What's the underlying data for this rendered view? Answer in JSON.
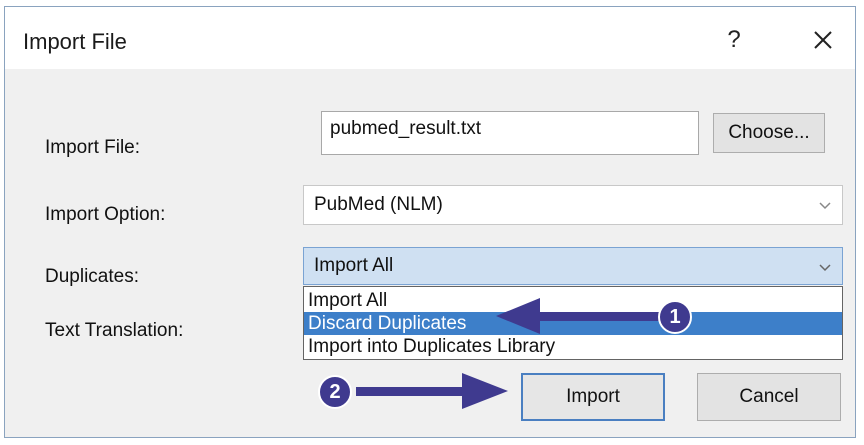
{
  "window": {
    "title": "Import File",
    "help_label": "?"
  },
  "form": {
    "import_file": {
      "label": "Import File:",
      "value": "pubmed_result.txt",
      "choose_label": "Choose..."
    },
    "import_option": {
      "label": "Import Option:",
      "value": "PubMed (NLM)"
    },
    "duplicates": {
      "label": "Duplicates:",
      "value": "Import All",
      "options": [
        "Import All",
        "Discard Duplicates",
        "Import into Duplicates Library"
      ],
      "highlighted_index": 1
    },
    "text_translation": {
      "label": "Text Translation:"
    }
  },
  "buttons": {
    "import_label": "Import",
    "cancel_label": "Cancel"
  },
  "annotations": {
    "badge_1": "1",
    "badge_2": "2",
    "arrow_color": "#3f3a8f"
  },
  "colors": {
    "selected_option_bg": "#3d7fc9",
    "open_select_bg": "#cfe0f2"
  }
}
